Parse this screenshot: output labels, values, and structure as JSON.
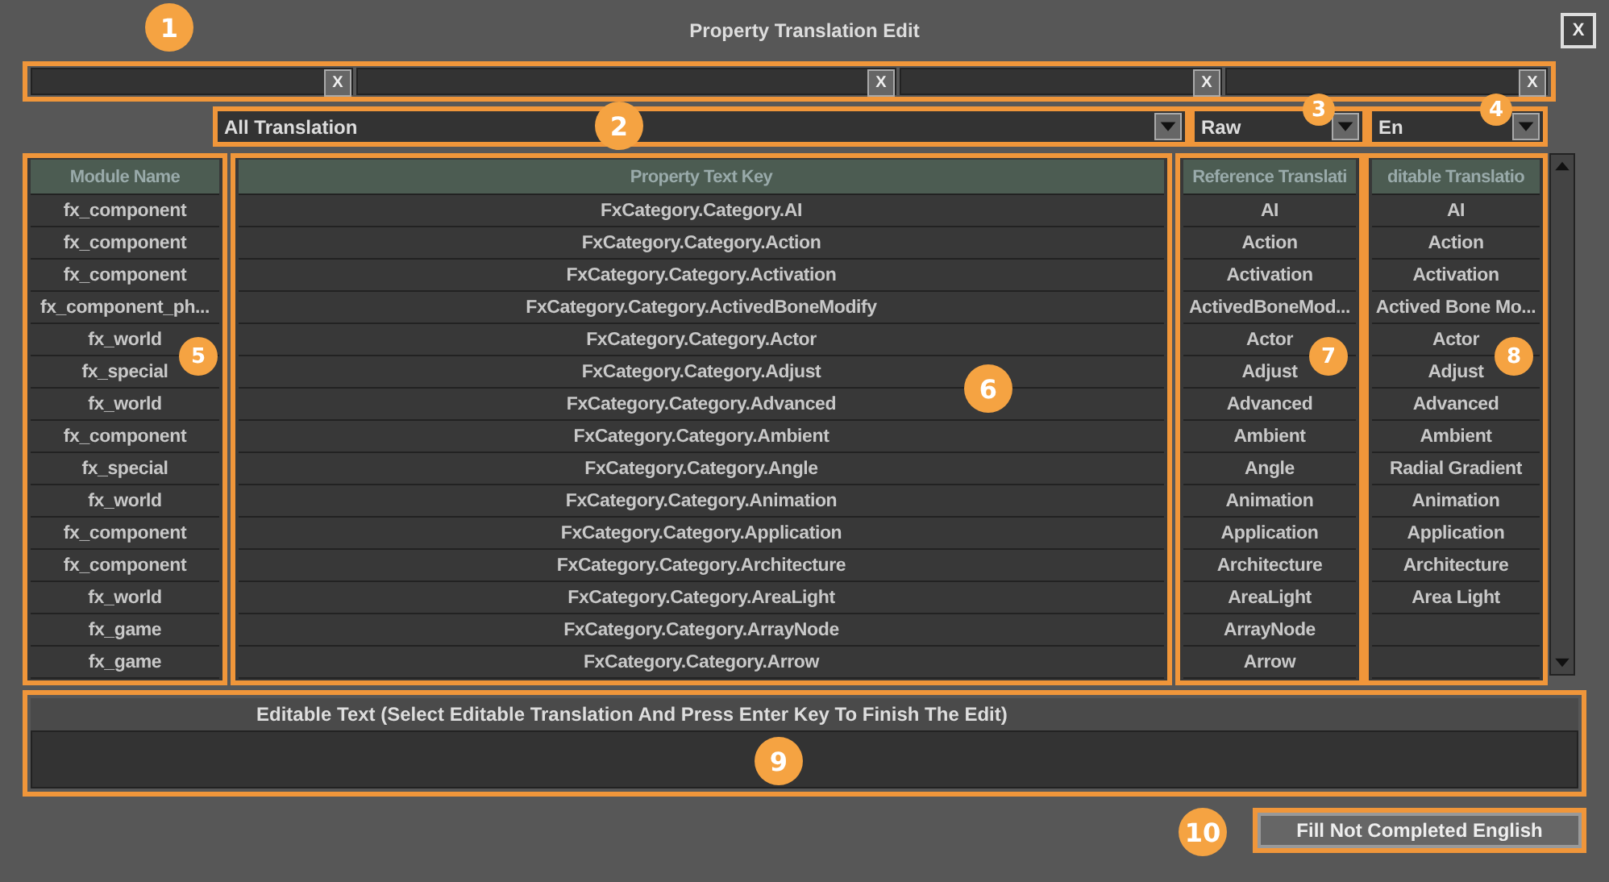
{
  "window": {
    "title": "Property Translation Edit",
    "close": "X"
  },
  "filters": [
    {
      "clear": "X"
    },
    {
      "clear": "X"
    },
    {
      "clear": "X"
    },
    {
      "clear": "X"
    }
  ],
  "dropdowns": [
    {
      "value": "All Translation"
    },
    {
      "value": "Raw"
    },
    {
      "value": "En"
    }
  ],
  "table": {
    "columns": [
      {
        "header": "Module Name",
        "cells": [
          "fx_component",
          "fx_component",
          "fx_component",
          "fx_component_ph...",
          "fx_world",
          "fx_special",
          "fx_world",
          "fx_component",
          "fx_special",
          "fx_world",
          "fx_component",
          "fx_component",
          "fx_world",
          "fx_game",
          "fx_game"
        ]
      },
      {
        "header": "Property Text Key",
        "cells": [
          "FxCategory.Category.AI",
          "FxCategory.Category.Action",
          "FxCategory.Category.Activation",
          "FxCategory.Category.ActivedBoneModify",
          "FxCategory.Category.Actor",
          "FxCategory.Category.Adjust",
          "FxCategory.Category.Advanced",
          "FxCategory.Category.Ambient",
          "FxCategory.Category.Angle",
          "FxCategory.Category.Animation",
          "FxCategory.Category.Application",
          "FxCategory.Category.Architecture",
          "FxCategory.Category.AreaLight",
          "FxCategory.Category.ArrayNode",
          "FxCategory.Category.Arrow"
        ]
      },
      {
        "header": "Reference Translati",
        "cells": [
          "AI",
          "Action",
          "Activation",
          "ActivedBoneMod...",
          "Actor",
          "Adjust",
          "Advanced",
          "Ambient",
          "Angle",
          "Animation",
          "Application",
          "Architecture",
          "AreaLight",
          "ArrayNode",
          "Arrow"
        ]
      },
      {
        "header": "ditable Translatio",
        "cells": [
          "AI",
          "Action",
          "Activation",
          "Actived Bone Mo...",
          "Actor",
          "Adjust",
          "Advanced",
          "Ambient",
          "Radial Gradient",
          "Animation",
          "Application",
          "Architecture",
          "Area Light"
        ]
      }
    ]
  },
  "edit_panel": {
    "title": "Editable Text (Select Editable Translation And Press Enter Key To Finish The Edit)"
  },
  "fill_button": "Fill Not Completed English",
  "callouts": [
    "1",
    "2",
    "3",
    "4",
    "5",
    "6",
    "7",
    "8",
    "9",
    "10"
  ]
}
